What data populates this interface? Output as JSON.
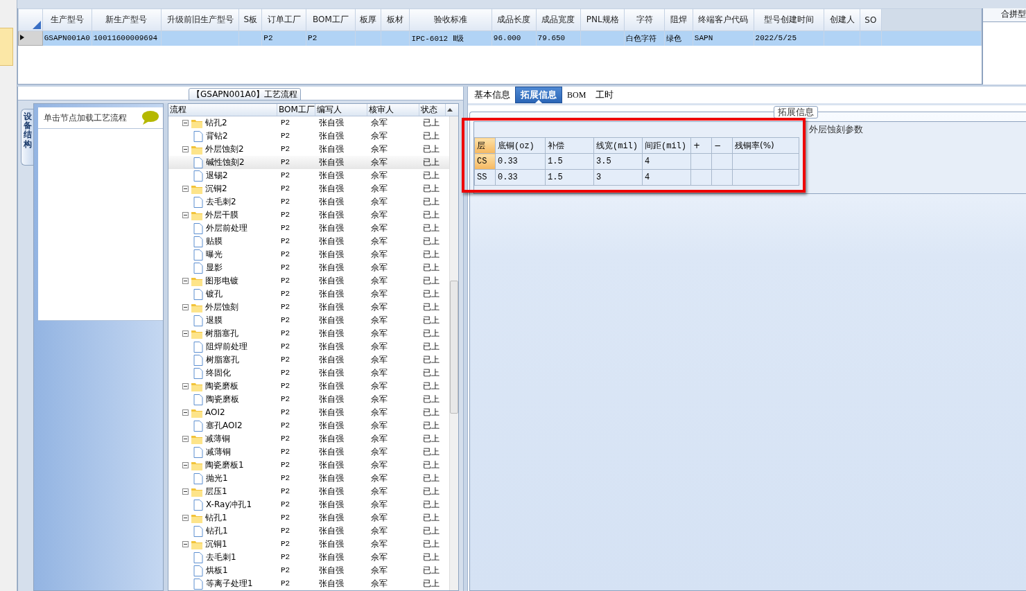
{
  "product_grid": {
    "columns": [
      "生产型号",
      "新生产型号",
      "升级前旧生产型号",
      "S板",
      "订单工厂",
      "BOM工厂",
      "板厚",
      "板材",
      "验收标准",
      "成品长度",
      "成品宽度",
      "PNL规格",
      "字符",
      "阻焊",
      "终端客户代码",
      "型号创建时间",
      "创建人",
      "SO"
    ],
    "rows": [
      {
        "selected": true,
        "cells": [
          "GSAPN001A0",
          "10011600009694",
          "",
          "",
          "P2",
          "P2",
          "",
          "",
          "IPC-6012 Ⅱ级",
          "96.000",
          "79.650",
          "",
          "白色字符",
          "绿色",
          "SAPN",
          "2022/5/25",
          "",
          ""
        ]
      }
    ]
  },
  "side_panel": {
    "title": "合拼型"
  },
  "flow_panel": {
    "title": "【GSAPN001A0】工艺流程",
    "side_tab": "设备结构",
    "hint": "单击节点加载工艺流程",
    "tree": {
      "columns": [
        "流程",
        "BOM工厂",
        "编写人",
        "核审人",
        "状态"
      ],
      "nodes": [
        {
          "name": "钻孔2",
          "bom": "P2",
          "writer": "张自强",
          "reviewer": "佘军",
          "status": "已上",
          "expanded": true,
          "selected": false,
          "children": [
            {
              "name": "背钻2",
              "bom": "P2",
              "writer": "张自强",
              "reviewer": "佘军",
              "status": "已上",
              "selected": false
            }
          ]
        },
        {
          "name": "外层蚀刻2",
          "bom": "P2",
          "writer": "张自强",
          "reviewer": "佘军",
          "status": "已上",
          "expanded": true,
          "selected": false,
          "children": [
            {
              "name": "碱性蚀刻2",
              "bom": "P2",
              "writer": "张自强",
              "reviewer": "佘军",
              "status": "已上",
              "selected": true
            },
            {
              "name": "退锡2",
              "bom": "P2",
              "writer": "张自强",
              "reviewer": "佘军",
              "status": "已上",
              "selected": false
            }
          ]
        },
        {
          "name": "沉铜2",
          "bom": "P2",
          "writer": "张自强",
          "reviewer": "佘军",
          "status": "已上",
          "expanded": true,
          "selected": false,
          "children": [
            {
              "name": "去毛刺2",
              "bom": "P2",
              "writer": "张自强",
              "reviewer": "佘军",
              "status": "已上",
              "selected": false
            }
          ]
        },
        {
          "name": "外层干膜",
          "bom": "P2",
          "writer": "张自强",
          "reviewer": "佘军",
          "status": "已上",
          "expanded": true,
          "selected": false,
          "children": [
            {
              "name": "外层前处理",
              "bom": "P2",
              "writer": "张自强",
              "reviewer": "佘军",
              "status": "已上",
              "selected": false
            },
            {
              "name": "贴膜",
              "bom": "P2",
              "writer": "张自强",
              "reviewer": "佘军",
              "status": "已上",
              "selected": false
            },
            {
              "name": "曝光",
              "bom": "P2",
              "writer": "张自强",
              "reviewer": "佘军",
              "status": "已上",
              "selected": false
            },
            {
              "name": "显影",
              "bom": "P2",
              "writer": "张自强",
              "reviewer": "佘军",
              "status": "已上",
              "selected": false
            }
          ]
        },
        {
          "name": "图形电镀",
          "bom": "P2",
          "writer": "张自强",
          "reviewer": "佘军",
          "status": "已上",
          "expanded": true,
          "selected": false,
          "children": [
            {
              "name": "镀孔",
              "bom": "P2",
              "writer": "张自强",
              "reviewer": "佘军",
              "status": "已上",
              "selected": false
            }
          ]
        },
        {
          "name": "外层蚀刻",
          "bom": "P2",
          "writer": "张自强",
          "reviewer": "佘军",
          "status": "已上",
          "expanded": true,
          "selected": false,
          "children": [
            {
              "name": "退膜",
              "bom": "P2",
              "writer": "张自强",
              "reviewer": "佘军",
              "status": "已上",
              "selected": false
            }
          ]
        },
        {
          "name": "树脂塞孔",
          "bom": "P2",
          "writer": "张自强",
          "reviewer": "佘军",
          "status": "已上",
          "expanded": true,
          "selected": false,
          "children": [
            {
              "name": "阻焊前处理",
              "bom": "P2",
              "writer": "张自强",
              "reviewer": "佘军",
              "status": "已上",
              "selected": false
            },
            {
              "name": "树脂塞孔",
              "bom": "P2",
              "writer": "张自强",
              "reviewer": "佘军",
              "status": "已上",
              "selected": false
            },
            {
              "name": "终固化",
              "bom": "P2",
              "writer": "张自强",
              "reviewer": "佘军",
              "status": "已上",
              "selected": false
            }
          ]
        },
        {
          "name": "陶瓷磨板",
          "bom": "P2",
          "writer": "张自强",
          "reviewer": "佘军",
          "status": "已上",
          "expanded": true,
          "selected": false,
          "children": [
            {
              "name": "陶瓷磨板",
              "bom": "P2",
              "writer": "张自强",
              "reviewer": "佘军",
              "status": "已上",
              "selected": false
            }
          ]
        },
        {
          "name": "AOI2",
          "bom": "P2",
          "writer": "张自强",
          "reviewer": "佘军",
          "status": "已上",
          "expanded": true,
          "selected": false,
          "children": [
            {
              "name": "塞孔AOI2",
              "bom": "P2",
              "writer": "张自强",
              "reviewer": "佘军",
              "status": "已上",
              "selected": false
            }
          ]
        },
        {
          "name": "减薄铜",
          "bom": "P2",
          "writer": "张自强",
          "reviewer": "佘军",
          "status": "已上",
          "expanded": true,
          "selected": false,
          "children": [
            {
              "name": "减薄铜",
              "bom": "P2",
              "writer": "张自强",
              "reviewer": "佘军",
              "status": "已上",
              "selected": false
            }
          ]
        },
        {
          "name": "陶瓷磨板1",
          "bom": "P2",
          "writer": "张自强",
          "reviewer": "佘军",
          "status": "已上",
          "expanded": true,
          "selected": false,
          "children": [
            {
              "name": "抛光1",
              "bom": "P2",
              "writer": "张自强",
              "reviewer": "佘军",
              "status": "已上",
              "selected": false
            }
          ]
        },
        {
          "name": "层压1",
          "bom": "P2",
          "writer": "张自强",
          "reviewer": "佘军",
          "status": "已上",
          "expanded": true,
          "selected": false,
          "children": [
            {
              "name": "X-Ray冲孔1",
              "bom": "P2",
              "writer": "张自强",
              "reviewer": "佘军",
              "status": "已上",
              "selected": false
            }
          ]
        },
        {
          "name": "钻孔1",
          "bom": "P2",
          "writer": "张自强",
          "reviewer": "佘军",
          "status": "已上",
          "expanded": true,
          "selected": false,
          "children": [
            {
              "name": "钻孔1",
              "bom": "P2",
              "writer": "张自强",
              "reviewer": "佘军",
              "status": "已上",
              "selected": false
            }
          ]
        },
        {
          "name": "沉铜1",
          "bom": "P2",
          "writer": "张自强",
          "reviewer": "佘军",
          "status": "已上",
          "expanded": true,
          "selected": false,
          "children": [
            {
              "name": "去毛刺1",
              "bom": "P2",
              "writer": "张自强",
              "reviewer": "佘军",
              "status": "已上",
              "selected": false
            },
            {
              "name": "烘板1",
              "bom": "P2",
              "writer": "张自强",
              "reviewer": "佘军",
              "status": "已上",
              "selected": false
            },
            {
              "name": "等离子处理1",
              "bom": "P2",
              "writer": "张自强",
              "reviewer": "佘军",
              "status": "已上",
              "selected": false
            }
          ]
        }
      ]
    }
  },
  "info_panel": {
    "tabs": [
      {
        "label": "基本信息",
        "selected": false
      },
      {
        "label": "拓展信息",
        "selected": true
      },
      {
        "label": "BOM",
        "selected": false
      },
      {
        "label": "工时",
        "selected": false
      }
    ],
    "group_title": "拓展信息",
    "section_title": "外层蚀刻参数",
    "highlighted": true,
    "params": {
      "columns": [
        "层",
        "底铜(oz)",
        "补偿",
        "线宽(mil)",
        "间距(mil)",
        "+",
        "−",
        "残铜率(%)"
      ],
      "rows": [
        {
          "selected": true,
          "cells": [
            "CS",
            "0.33",
            "1.5",
            "3.5",
            "4",
            "",
            "",
            ""
          ]
        },
        {
          "selected": false,
          "cells": [
            "SS",
            "0.33",
            "1.5",
            "3",
            "4",
            "",
            "",
            ""
          ]
        }
      ]
    }
  }
}
